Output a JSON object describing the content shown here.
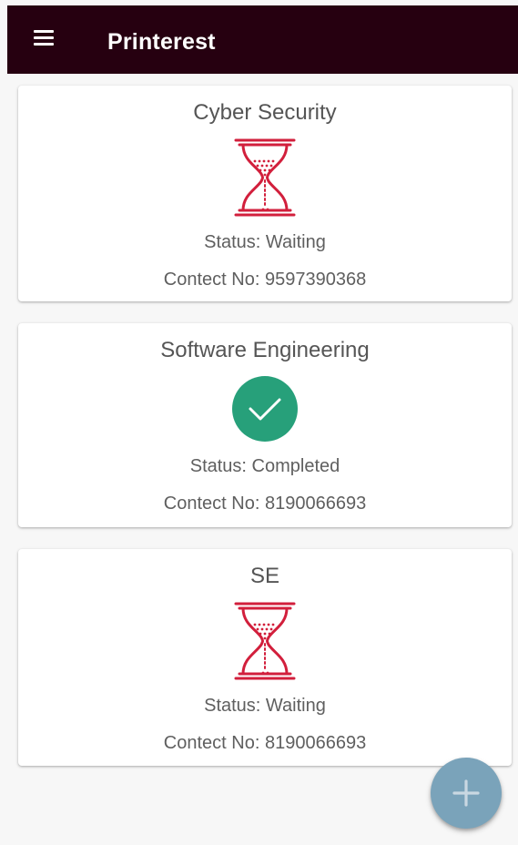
{
  "app": {
    "title": "Printerest"
  },
  "colors": {
    "appbar": "#260010",
    "waiting_icon": "#d21f3c",
    "completed_icon": "#27a07a",
    "fab": "#7aa3ba"
  },
  "orders": [
    {
      "title": "Cyber Security",
      "status_icon": "hourglass-icon",
      "status": "Status: Waiting",
      "contact": "Contect No: 9597390368"
    },
    {
      "title": "Software Engineering",
      "status_icon": "check-circle-icon",
      "status": "Status: Completed",
      "contact": "Contect No: 8190066693"
    },
    {
      "title": "SE",
      "status_icon": "hourglass-icon",
      "status": "Status: Waiting",
      "contact": "Contect No: 8190066693"
    }
  ],
  "fab": {
    "icon": "plus-icon"
  }
}
